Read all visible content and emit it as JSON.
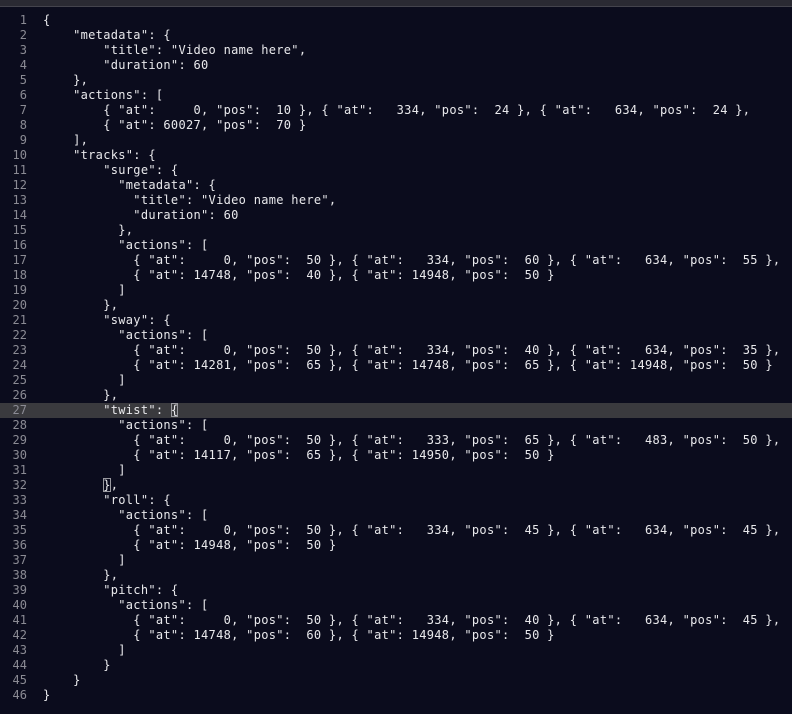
{
  "editor": {
    "current_line": 27,
    "bracket_match_lines": [
      27,
      32
    ],
    "lines": [
      {
        "num": "1",
        "text": "{"
      },
      {
        "num": "2",
        "text": "    \"metadata\": {"
      },
      {
        "num": "3",
        "text": "        \"title\": \"Video name here\","
      },
      {
        "num": "4",
        "text": "        \"duration\": 60"
      },
      {
        "num": "5",
        "text": "    },"
      },
      {
        "num": "6",
        "text": "    \"actions\": ["
      },
      {
        "num": "7",
        "text": "        { \"at\":     0, \"pos\":  10 }, { \"at\":   334, \"pos\":  24 }, { \"at\":   634, \"pos\":  24 },"
      },
      {
        "num": "8",
        "text": "        { \"at\": 60027, \"pos\":  70 }"
      },
      {
        "num": "9",
        "text": "    ],"
      },
      {
        "num": "10",
        "text": "    \"tracks\": {"
      },
      {
        "num": "11",
        "text": "        \"surge\": {"
      },
      {
        "num": "12",
        "text": "          \"metadata\": {"
      },
      {
        "num": "13",
        "text": "            \"title\": \"Video name here\","
      },
      {
        "num": "14",
        "text": "            \"duration\": 60"
      },
      {
        "num": "15",
        "text": "          },"
      },
      {
        "num": "16",
        "text": "          \"actions\": ["
      },
      {
        "num": "17",
        "text": "            { \"at\":     0, \"pos\":  50 }, { \"at\":   334, \"pos\":  60 }, { \"at\":   634, \"pos\":  55 },"
      },
      {
        "num": "18",
        "text": "            { \"at\": 14748, \"pos\":  40 }, { \"at\": 14948, \"pos\":  50 }"
      },
      {
        "num": "19",
        "text": "          ]"
      },
      {
        "num": "20",
        "text": "        },"
      },
      {
        "num": "21",
        "text": "        \"sway\": {"
      },
      {
        "num": "22",
        "text": "          \"actions\": ["
      },
      {
        "num": "23",
        "text": "            { \"at\":     0, \"pos\":  50 }, { \"at\":   334, \"pos\":  40 }, { \"at\":   634, \"pos\":  35 },"
      },
      {
        "num": "24",
        "text": "            { \"at\": 14281, \"pos\":  65 }, { \"at\": 14748, \"pos\":  65 }, { \"at\": 14948, \"pos\":  50 }"
      },
      {
        "num": "25",
        "text": "          ]"
      },
      {
        "num": "26",
        "text": "        },"
      },
      {
        "num": "27",
        "text": "        \"twist\": {"
      },
      {
        "num": "28",
        "text": "          \"actions\": ["
      },
      {
        "num": "29",
        "text": "            { \"at\":     0, \"pos\":  50 }, { \"at\":   333, \"pos\":  65 }, { \"at\":   483, \"pos\":  50 },"
      },
      {
        "num": "30",
        "text": "            { \"at\": 14117, \"pos\":  65 }, { \"at\": 14950, \"pos\":  50 }"
      },
      {
        "num": "31",
        "text": "          ]"
      },
      {
        "num": "32",
        "text": "        },"
      },
      {
        "num": "33",
        "text": "        \"roll\": {"
      },
      {
        "num": "34",
        "text": "          \"actions\": ["
      },
      {
        "num": "35",
        "text": "            { \"at\":     0, \"pos\":  50 }, { \"at\":   334, \"pos\":  45 }, { \"at\":   634, \"pos\":  45 },"
      },
      {
        "num": "36",
        "text": "            { \"at\": 14948, \"pos\":  50 }"
      },
      {
        "num": "37",
        "text": "          ]"
      },
      {
        "num": "38",
        "text": "        },"
      },
      {
        "num": "39",
        "text": "        \"pitch\": {"
      },
      {
        "num": "40",
        "text": "          \"actions\": ["
      },
      {
        "num": "41",
        "text": "            { \"at\":     0, \"pos\":  50 }, { \"at\":   334, \"pos\":  40 }, { \"at\":   634, \"pos\":  45 },"
      },
      {
        "num": "42",
        "text": "            { \"at\": 14748, \"pos\":  60 }, { \"at\": 14948, \"pos\":  50 }"
      },
      {
        "num": "43",
        "text": "          ]"
      },
      {
        "num": "44",
        "text": "        }"
      },
      {
        "num": "45",
        "text": "    }"
      },
      {
        "num": "46",
        "text": "}"
      }
    ]
  }
}
